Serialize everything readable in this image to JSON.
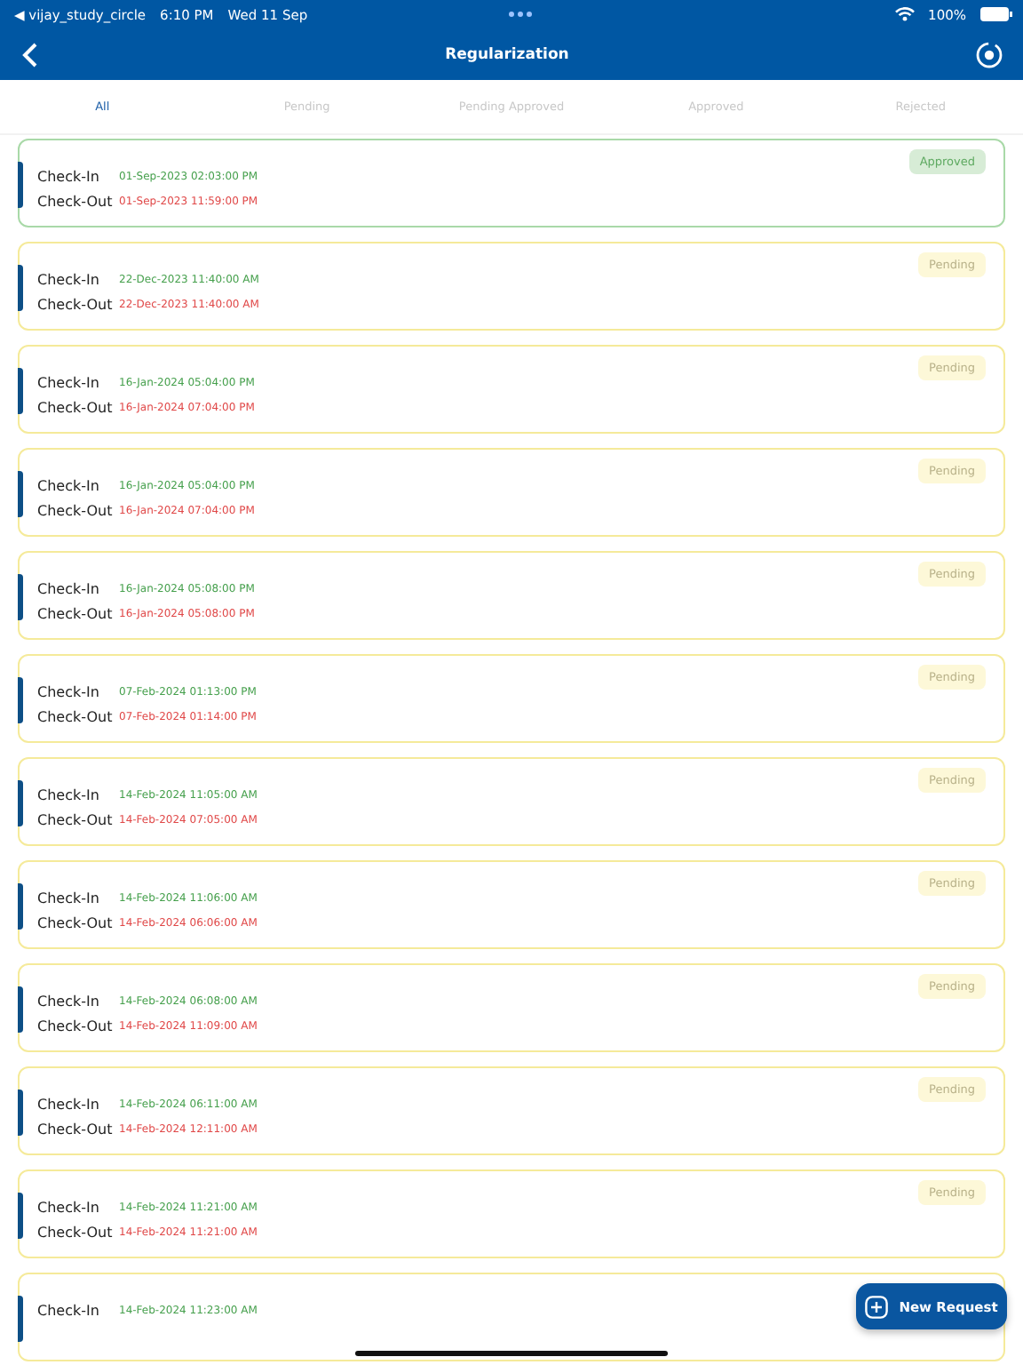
{
  "status_bar": {
    "back_app": "◀ vijay_study_circle",
    "time": "6:10 PM",
    "date": "Wed 11 Sep",
    "battery": "100%"
  },
  "header": {
    "title": "Regularization"
  },
  "tabs": [
    {
      "label": "All",
      "selected": true
    },
    {
      "label": "Pending",
      "selected": false
    },
    {
      "label": "Pending Approved",
      "selected": false
    },
    {
      "label": "Approved",
      "selected": false
    },
    {
      "label": "Rejected",
      "selected": false
    }
  ],
  "requests": [
    {
      "status": "Approved",
      "kind": "approved",
      "check_in_label": "Check-In",
      "check_in": "01-Sep-2023 02:03:00 PM",
      "check_out_label": "Check-Out",
      "check_out": "01-Sep-2023 11:59:00 PM"
    },
    {
      "status": "Pending",
      "kind": "pending",
      "check_in_label": "Check-In",
      "check_in": "22-Dec-2023 11:40:00 AM",
      "check_out_label": "Check-Out",
      "check_out": "22-Dec-2023 11:40:00 AM"
    },
    {
      "status": "Pending",
      "kind": "pending",
      "check_in_label": "Check-In",
      "check_in": "16-Jan-2024 05:04:00 PM",
      "check_out_label": "Check-Out",
      "check_out": "16-Jan-2024 07:04:00 PM"
    },
    {
      "status": "Pending",
      "kind": "pending",
      "check_in_label": "Check-In",
      "check_in": "16-Jan-2024 05:04:00 PM",
      "check_out_label": "Check-Out",
      "check_out": "16-Jan-2024 07:04:00 PM"
    },
    {
      "status": "Pending",
      "kind": "pending",
      "check_in_label": "Check-In",
      "check_in": "16-Jan-2024 05:08:00 PM",
      "check_out_label": "Check-Out",
      "check_out": "16-Jan-2024 05:08:00 PM"
    },
    {
      "status": "Pending",
      "kind": "pending",
      "check_in_label": "Check-In",
      "check_in": "07-Feb-2024 01:13:00 PM",
      "check_out_label": "Check-Out",
      "check_out": "07-Feb-2024 01:14:00 PM"
    },
    {
      "status": "Pending",
      "kind": "pending",
      "check_in_label": "Check-In",
      "check_in": "14-Feb-2024 11:05:00 AM",
      "check_out_label": "Check-Out",
      "check_out": "14-Feb-2024 07:05:00 AM"
    },
    {
      "status": "Pending",
      "kind": "pending",
      "check_in_label": "Check-In",
      "check_in": "14-Feb-2024 11:06:00 AM",
      "check_out_label": "Check-Out",
      "check_out": "14-Feb-2024 06:06:00 AM"
    },
    {
      "status": "Pending",
      "kind": "pending",
      "check_in_label": "Check-In",
      "check_in": "14-Feb-2024 06:08:00 AM",
      "check_out_label": "Check-Out",
      "check_out": "14-Feb-2024 11:09:00 AM"
    },
    {
      "status": "Pending",
      "kind": "pending",
      "check_in_label": "Check-In",
      "check_in": "14-Feb-2024 06:11:00 AM",
      "check_out_label": "Check-Out",
      "check_out": "14-Feb-2024 12:11:00 AM"
    },
    {
      "status": "Pending",
      "kind": "pending",
      "check_in_label": "Check-In",
      "check_in": "14-Feb-2024 11:21:00 AM",
      "check_out_label": "Check-Out",
      "check_out": "14-Feb-2024 11:21:00 AM"
    },
    {
      "kind": "pending",
      "check_in_label": "Check-In",
      "check_in": "14-Feb-2024 11:23:00 AM"
    }
  ],
  "fab": {
    "label": "New Request"
  }
}
